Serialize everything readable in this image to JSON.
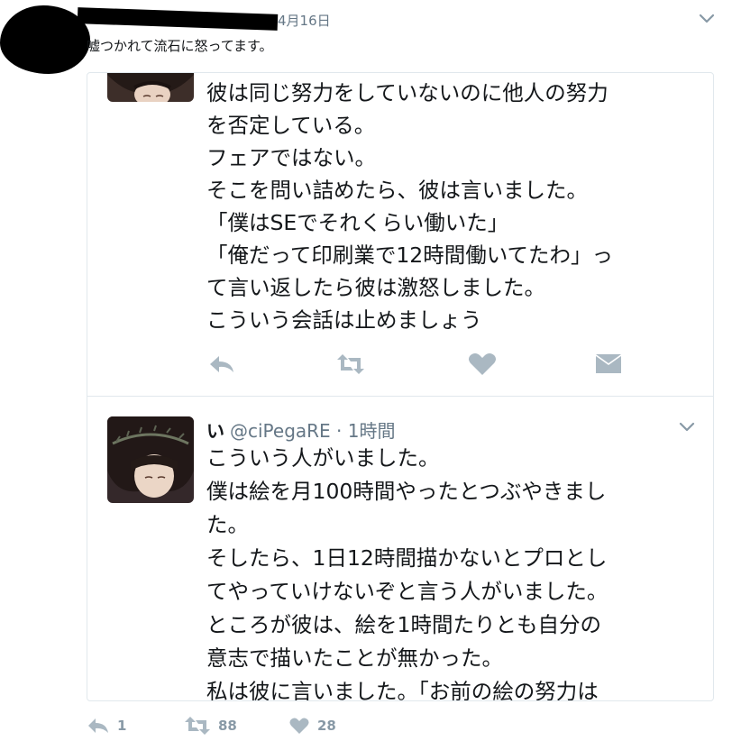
{
  "tweet": {
    "date": "4月16日",
    "text": "嘘つかれて流石に怒ってます。"
  },
  "quoted": {
    "reply1": {
      "text": "彼は同じ努力をしていないのに他人の努力\nを否定している。\nフェアではない。\nそこを問い詰めたら、彼は言いました。\n「僕はSEでそれくらい働いた」\n「俺だって印刷業で12時間働いてたわ」っ\nて言い返したら彼は激怒しました。\nこういう会話は止めましょう"
    },
    "reply2": {
      "name": "い",
      "handle": "@ciPegaRE · 1時間",
      "text": "こういう人がいました。\n僕は絵を月100時間やったとつぶやきまし\nた。\nそしたら、1日12時間描かないとプロとし\nてやっていけないぞと言う人がいました。\nところが彼は、絵を1時間たりとも自分の\n意志で描いたことが無かった。\n私は彼に言いました。「お前の絵の努力は"
    }
  },
  "actions": {
    "reply_count": "1",
    "retweet_count": "88",
    "like_count": "28"
  },
  "colors": {
    "text": "#14171a",
    "muted": "#657786",
    "icon": "#aab8c2",
    "border": "#e1e8ed"
  }
}
